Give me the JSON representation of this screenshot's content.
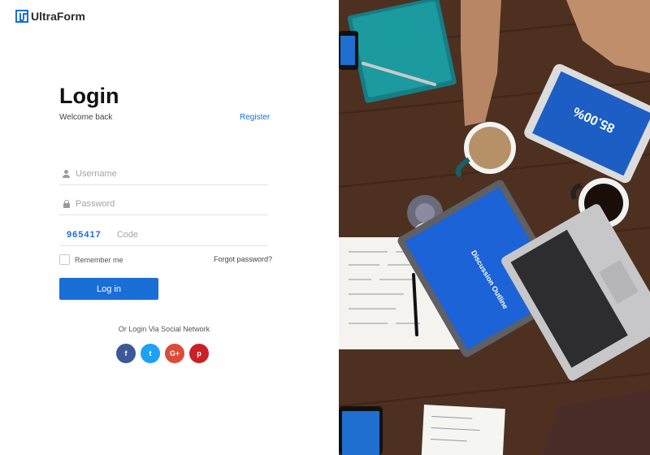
{
  "brand": {
    "name": "UltraForm",
    "color": "#1a6ed8"
  },
  "login": {
    "title": "Login",
    "welcome": "Welcome back",
    "register": "Register",
    "username_placeholder": "Username",
    "password_placeholder": "Password",
    "captcha_code": "965417",
    "code_placeholder": "Code",
    "remember_label": "Remember me",
    "forgot_label": "Forgot password?",
    "submit_label": "Log in"
  },
  "social": {
    "label": "Or Login Via Social Network",
    "buttons": [
      {
        "name": "facebook",
        "glyph": "f",
        "color": "#3b5998"
      },
      {
        "name": "twitter",
        "glyph": "t",
        "color": "#1da1f2"
      },
      {
        "name": "google-plus",
        "glyph": "G+",
        "color": "#dd4b39"
      },
      {
        "name": "pinterest",
        "glyph": "p",
        "color": "#cb2027"
      }
    ]
  },
  "hero_photo": {
    "tablet_text": "85.00%",
    "laptop_text": "Discussion Outline"
  }
}
